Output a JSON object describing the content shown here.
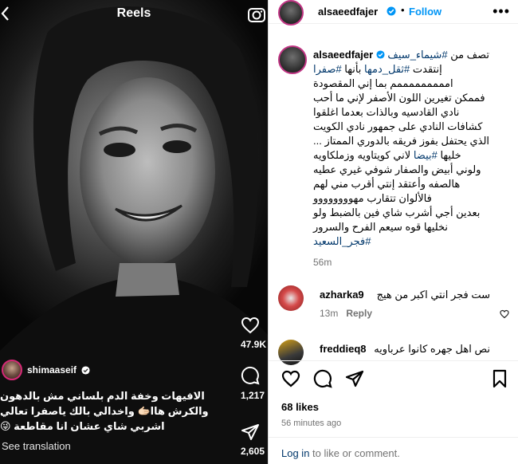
{
  "reel": {
    "title": "Reels",
    "back_icon": "chevron-left-icon",
    "camera_icon": "camera-icon",
    "author": {
      "username": "shimaaseif"
    },
    "caption_lines": [
      "الافيهات وخفة الدم بلساني مش بالدهون",
      "والكرش هاا🫱🏻 واخدالي بالك ياصفرا تعالي",
      "اشربي شاي عشان انا مقاطعة 😜"
    ],
    "see_translation": "See translation",
    "likes_count": "47.9K",
    "comments_count": "1,217",
    "shares_count": "2,605"
  },
  "post": {
    "header": {
      "username": "alsaeedfajer",
      "dot": "•",
      "follow_label": "Follow",
      "more_icon": "more-horizontal-icon"
    },
    "caption": {
      "username": "alsaeedfajer",
      "mention_tag": "#شيماء_سيف",
      "describes": "تصف من",
      "line2_prefix": "إنتقدت",
      "line2_tag": "#ثقل_دمها",
      "line2_mid": "بأنها",
      "line2_tag2": "#صفرا",
      "body": "امممممممممم بما إني المقصودة\nفممكن تغيرين اللون الأصفر لإني ما أحب\nنادي القادسيه وبالذات بعدما اغلقوا\nكشافات النادي على جمهور نادي الكويت\nالذي يحتفل بفوز فريقه بالدوري الممتاز ...",
      "line_tag_white_prefix": "خليها",
      "line_tag_white": "#بيضا",
      "line_tag_white_suffix": "لاني كويتاويه وزملكاويه",
      "body2": "ولوني أبيض والصفار شوفي غيري عطيه\nهالصفه وأعتقد إنتي أقرب مني لهم\nفالألوان تتقارب مهوووووووو\nبعدين أجي أشرب شاي فين بالضبط ولو\nنخليها قوه سيعم الفرح والسرور",
      "final_tag": "#فجر_السعيد",
      "time": "56m"
    },
    "comments": [
      {
        "username": "azharka9",
        "text": "ست فجر انتي اكبر من هيج",
        "time": "13m",
        "reply_label": "Reply"
      },
      {
        "username": "freddieq8",
        "text": "نص اهل جهره كانوا عرباويه"
      }
    ],
    "likes": "68 likes",
    "time_ago": "56 minutes ago",
    "login": {
      "link_label": "Log in",
      "rest": " to like or comment."
    }
  }
}
